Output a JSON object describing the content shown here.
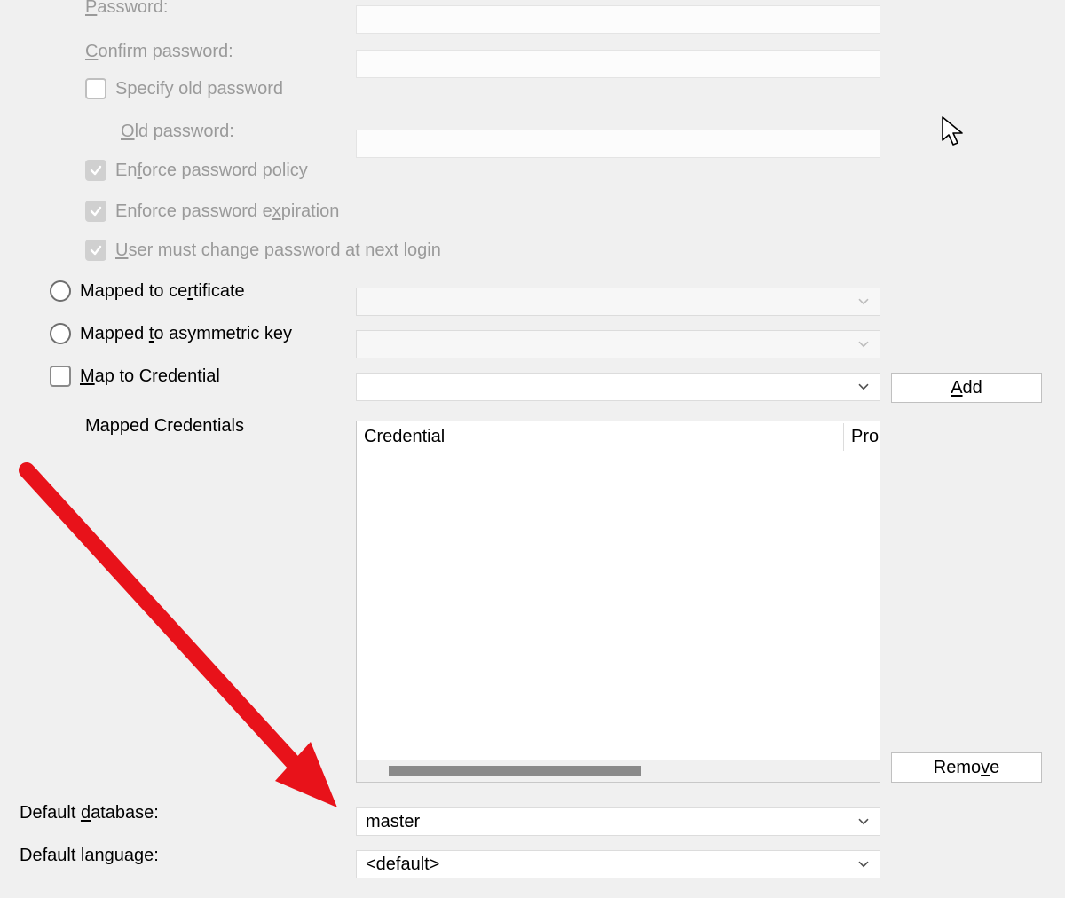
{
  "passwordSection": {
    "password_label_pre": "",
    "password_label_u": "P",
    "password_label_post": "assword:",
    "confirm_label_pre": "",
    "confirm_label_u": "C",
    "confirm_label_post": "onfirm password:",
    "specify_old_label": "Specify old password",
    "old_label_pre": "",
    "old_label_u": "O",
    "old_label_post": "ld password:",
    "enforce_policy_pre": "En",
    "enforce_policy_u": "f",
    "enforce_policy_post": "orce password policy",
    "enforce_expiration_pre": "Enforce password e",
    "enforce_expiration_u": "x",
    "enforce_expiration_post": "piration",
    "must_change_pre": "",
    "must_change_u": "U",
    "must_change_post": "ser must change password at next login"
  },
  "mapping": {
    "cert_label_pre": "Mapped to ce",
    "cert_label_u": "r",
    "cert_label_post": "tificate",
    "asym_label_pre": "Mapped ",
    "asym_label_u": "t",
    "asym_label_post": "o asymmetric key",
    "map_cred_pre": "",
    "map_cred_u": "M",
    "map_cred_post": "ap to Credential",
    "mapped_creds_label": "Mapped Credentials",
    "add_button_pre": "",
    "add_button_u": "A",
    "add_button_post": "dd",
    "remove_button_pre": "Remo",
    "remove_button_u": "v",
    "remove_button_post": "e"
  },
  "credTable": {
    "col1": "Credential",
    "col2_visible": "Pro"
  },
  "defaults": {
    "db_label_pre": "Default ",
    "db_label_u": "d",
    "db_label_post": "atabase:",
    "db_value": "master",
    "lang_label_pre": "Default lan",
    "lang_label_u": "g",
    "lang_label_post": "uage:",
    "lang_value": "<default>"
  }
}
